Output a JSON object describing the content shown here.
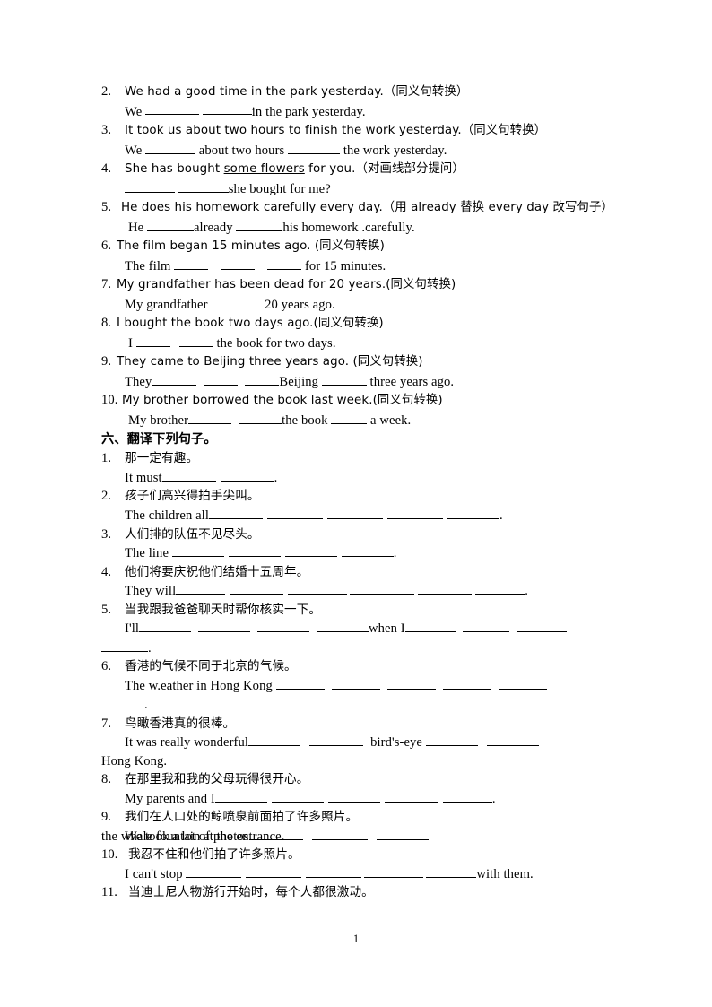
{
  "document": {
    "page_number": "1",
    "section_heading": "六、翻译下列句子。"
  },
  "rewrite_exercises": [
    {
      "num": "2.",
      "prompt": "We had a good time in the park yesterday.（同义句转换）",
      "answer_pre": "We ",
      "answer_mid": " ",
      "answer_post": "in the park yesterday.",
      "blanks": [
        60,
        55
      ]
    },
    {
      "num": "3.",
      "prompt": "It took us about two hours to finish the work yesterday.（同义句转换）",
      "answer_pre": "We ",
      "answer_mid": " about two hours ",
      "answer_post": " the work yesterday.",
      "blanks": [
        56,
        58
      ]
    },
    {
      "num": "4.",
      "prompt_a": "She has bought ",
      "prompt_underlined": "some flowers",
      "prompt_b": " for you.（对画线部分提问）",
      "answer_pre": "",
      "answer_mid": " ",
      "answer_post": "she bought for me?",
      "blanks": [
        56,
        56
      ]
    },
    {
      "num": "5.",
      "prompt": "He does his homework carefully every day.（用 already 替换 every day 改写句子）",
      "answer_pre": "He ",
      "answer_mid": "already ",
      "answer_post": "his homework .carefully.",
      "blanks": [
        52,
        52
      ]
    },
    {
      "num": "6.",
      "prompt": "The film began 15 minutes ago. (同义句转换)",
      "answer_pre": "The film  ",
      "answer_post": " for 15 minutes.",
      "blanks": [
        38,
        38,
        38
      ]
    },
    {
      "num": "7.",
      "prompt": "My grandfather has been dead for 20 years.(同义句转换)",
      "answer_pre": "My grandfather  ",
      "answer_post": " 20 years ago.",
      "blanks": [
        56
      ]
    },
    {
      "num": "8.",
      "prompt": "I bought the book two days ago.(同义句转换)",
      "answer_pre": "I  ",
      "answer_post": "  the book for two days.",
      "blanks": [
        38,
        38
      ]
    },
    {
      "num": "9.",
      "prompt": "They came to Beijing three years ago. (同义句转换)",
      "answer_pre": "They",
      "answer_mid": "Beijing ",
      "answer_post": " three years ago.",
      "blanks": [
        50,
        38,
        38,
        50
      ]
    },
    {
      "num": "10.",
      "prompt": "My brother borrowed the book last week.(同义句转换)",
      "answer_pre": "My brother",
      "answer_mid": "the book  ",
      "answer_post": " a week.",
      "blanks": [
        48,
        48,
        40
      ]
    }
  ],
  "translate_exercises": [
    {
      "num": "1.",
      "chinese": "那一定有趣。",
      "answer_pre": "It must",
      "answer_post": ".",
      "blanks": [
        60,
        60
      ]
    },
    {
      "num": "2.",
      "chinese": "孩子们高兴得拍手尖叫。",
      "answer_pre": "The children all",
      "answer_post": ".",
      "blanks": [
        60,
        62,
        62,
        62,
        58
      ]
    },
    {
      "num": "3.",
      "chinese": "人们排的队伍不见尽头。",
      "answer_pre": "The line ",
      "answer_post": ".",
      "blanks": [
        58,
        58,
        58,
        58
      ]
    },
    {
      "num": "4.",
      "chinese": "他们将要庆祝他们结婚十五周年。",
      "answer_pre": "They will",
      "answer_post": ".",
      "blanks": [
        55,
        60,
        66,
        72,
        60,
        55
      ]
    },
    {
      "num": "5.",
      "chinese": "当我跟我爸爸聊天时帮你核实一下。",
      "answer_pre": "I'll",
      "answer_mid": "when  I",
      "answer_post": ".",
      "blanks_a": [
        58,
        58,
        58,
        58
      ],
      "blanks_b": [
        56,
        52,
        56
      ],
      "blanks_c": [
        52
      ]
    },
    {
      "num": "6.",
      "chinese": "香港的气候不同于北京的气候。",
      "answer_pre": "The  w.eather  in  Hong  Kong  ",
      "answer_post": ".",
      "blanks_a": [
        54,
        54,
        54,
        54,
        54
      ],
      "blanks_c": [
        48
      ]
    },
    {
      "num": "7.",
      "chinese": "鸟瞰香港真的很棒。",
      "answer_pre": "It  was  really  wonderful",
      "answer_mid": "bird's-eye  ",
      "answer_post": "Hong Kong.",
      "blanks": [
        58,
        60,
        58,
        58
      ]
    },
    {
      "num": "8.",
      "chinese": "在那里我和我的父母玩得很开心。",
      "answer_pre": "My parents and I",
      "answer_post": ".",
      "blanks": [
        58,
        58,
        58,
        60,
        55
      ]
    },
    {
      "num": "9.",
      "chinese": "我们在人口处的鲸喷泉前面拍了许多照片。",
      "answer_pre": "We  took  a  lot  of  photos",
      "answer_post": "the whale fountain at the entrance.",
      "blanks": [
        60,
        62,
        58
      ]
    },
    {
      "num": "10.",
      "chinese": "我忍不住和他们拍了许多照片。",
      "answer_pre": "I can't stop ",
      "answer_post": "with them.",
      "blanks": [
        62,
        62,
        62,
        66,
        56
      ]
    },
    {
      "num": "11.",
      "chinese": "当迪士尼人物游行开始时，每个人都很激动。"
    }
  ]
}
